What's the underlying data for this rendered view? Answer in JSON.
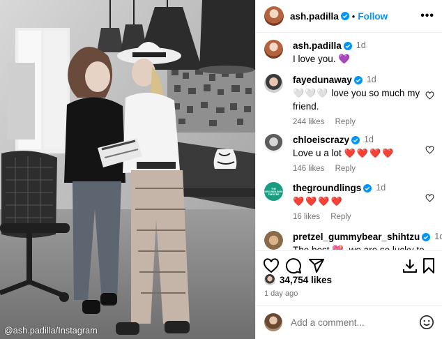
{
  "photo": {
    "credit": "@ash.padilla/Instagram"
  },
  "post": {
    "author": "ash.padilla",
    "follow_label": "Follow",
    "more_label": "•••",
    "caption_text": "I love you. 💜",
    "caption_time": "1d"
  },
  "comments": [
    {
      "username": "fayedunaway",
      "time": "1d",
      "hearts": "🤍🤍🤍",
      "text": "love you so much my friend.",
      "likes": "244 likes",
      "reply": "Reply"
    },
    {
      "username": "chloeiscrazy",
      "time": "1d",
      "text": "Love u a lot",
      "hearts": "❤️❤️❤️❤️",
      "likes": "146 likes",
      "reply": "Reply"
    },
    {
      "username": "thegroundlings",
      "time": "1d",
      "text": "",
      "hearts": "❤️❤️❤️❤️",
      "likes": "16 likes",
      "reply": "Reply",
      "avatar_text": "THE GROUNDLINGS THEATRE"
    },
    {
      "username": "pretzel_gummybear_shihtzu",
      "time": "1d",
      "text": "The best 💖, we are so lucky to"
    }
  ],
  "actions": {
    "like_count": "34,754 likes",
    "date": "1 day ago",
    "comment_placeholder": "Add a comment..."
  },
  "colors": {
    "accent": "#0095f6",
    "heart": "#ed1b45",
    "verified": "#0095f6",
    "muted": "#737373"
  },
  "icons": [
    "verified-badge-icon",
    "more-icon",
    "heart-icon",
    "comment-icon",
    "share-icon",
    "download-icon",
    "save-icon",
    "emoji-icon"
  ]
}
